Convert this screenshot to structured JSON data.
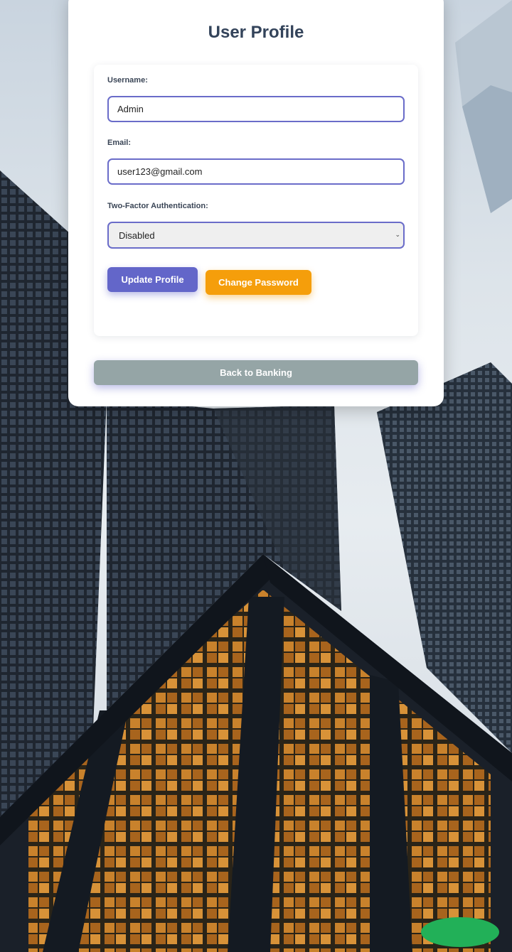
{
  "page": {
    "title": "User Profile"
  },
  "form": {
    "username_label": "Username:",
    "username_value": "Admin",
    "email_label": "Email:",
    "email_value": "user123@gmail.com",
    "two_factor_label": "Two-Factor Authentication:",
    "two_factor_value": "Disabled"
  },
  "buttons": {
    "update_profile": "Update Profile",
    "change_password": "Change Password",
    "back_to_banking": "Back to Banking"
  },
  "colors": {
    "title": "#33435a",
    "input_border": "#6a6cc9",
    "update_button": "#6366c9",
    "change_button": "#f59e0b",
    "back_button": "#95a5a6",
    "chat_button": "#22b058"
  },
  "icons": {
    "select_chevron": "chevron-down-icon"
  }
}
